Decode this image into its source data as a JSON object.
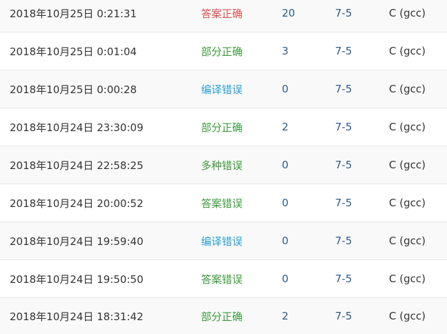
{
  "colors": {
    "accepted": "#d9534f",
    "partial": "#3c9a3c",
    "compile_error": "#2a9fd6",
    "wrong": "#3c9a3c",
    "link": "#2a5a8c",
    "row_stripe": "#f9f9f9",
    "row_border": "#e6e6e6"
  },
  "submissions": [
    {
      "time": "2018年10月25日 0:21:31",
      "status": "答案正确",
      "status_kind": "ac",
      "score": "20",
      "problem": "7-5",
      "lang": "C (gcc)"
    },
    {
      "time": "2018年10月25日 0:01:04",
      "status": "部分正确",
      "status_kind": "pa",
      "score": "3",
      "problem": "7-5",
      "lang": "C (gcc)"
    },
    {
      "time": "2018年10月25日 0:00:28",
      "status": "编译错误",
      "status_kind": "ce",
      "score": "0",
      "problem": "7-5",
      "lang": "C (gcc)"
    },
    {
      "time": "2018年10月24日 23:30:09",
      "status": "部分正确",
      "status_kind": "pa",
      "score": "2",
      "problem": "7-5",
      "lang": "C (gcc)"
    },
    {
      "time": "2018年10月24日 22:58:25",
      "status": "多种错误",
      "status_kind": "me",
      "score": "0",
      "problem": "7-5",
      "lang": "C (gcc)"
    },
    {
      "time": "2018年10月24日 20:00:52",
      "status": "答案错误",
      "status_kind": "wa",
      "score": "0",
      "problem": "7-5",
      "lang": "C (gcc)"
    },
    {
      "time": "2018年10月24日 19:59:40",
      "status": "编译错误",
      "status_kind": "ce",
      "score": "0",
      "problem": "7-5",
      "lang": "C (gcc)"
    },
    {
      "time": "2018年10月24日 19:50:50",
      "status": "答案错误",
      "status_kind": "wa",
      "score": "0",
      "problem": "7-5",
      "lang": "C (gcc)"
    },
    {
      "time": "2018年10月24日 18:31:42",
      "status": "部分正确",
      "status_kind": "pa",
      "score": "2",
      "problem": "7-5",
      "lang": "C (gcc)"
    }
  ]
}
